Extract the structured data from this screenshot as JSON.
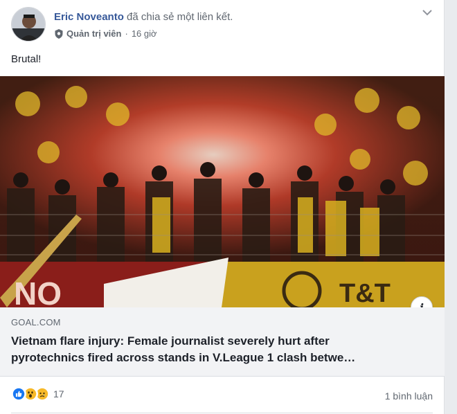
{
  "post": {
    "author": "Eric Noveanto",
    "action": "đã chia sẻ một liên kết.",
    "role": "Quản trị viên",
    "separator": "·",
    "time": "16 giờ",
    "text": "Brutal!"
  },
  "link": {
    "domain": "GOAL.COM",
    "title_line1": "Vietnam flare injury: Female journalist severely hurt after",
    "title_line2": "pyrotechnics fired across stands in V.League 1 clash betwe…",
    "info_glyph": "i",
    "image_banner_left": "NO",
    "image_banner_right": "T&T"
  },
  "footer": {
    "reactions": [
      "like-icon",
      "wow-icon",
      "sad-icon"
    ],
    "reaction_count": "17",
    "comments": "1 bình luận"
  },
  "colors": {
    "author_blue": "#365899",
    "meta_gray": "#606770",
    "card_bg": "#f2f3f5",
    "like_blue": "#1877f2",
    "emoji_yellow": "#f7b928"
  }
}
